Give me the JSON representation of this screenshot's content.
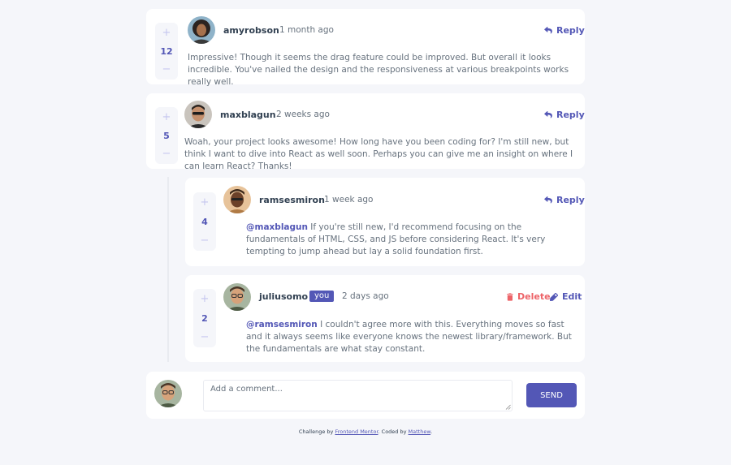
{
  "colors": {
    "accent": "#5357b6",
    "delete": "#ed6368",
    "background": "#f5f6fa",
    "card": "#ffffff",
    "vote_button": "#c5c6ef"
  },
  "vote": {
    "up_symbol": "+",
    "down_symbol": "−"
  },
  "comments": [
    {
      "score": "12",
      "username": "amyrobson",
      "time": "1 month ago",
      "reply_label": "Reply",
      "content": "Impressive! Though it seems the drag feature could be improved. But overall it looks incredible. You've nailed the design and the responsiveness at various breakpoints works really well."
    },
    {
      "score": "5",
      "username": "maxblagun",
      "time": "2 weeks ago",
      "reply_label": "Reply",
      "content": "Woah, your project looks awesome! How long have you been coding for? I'm still new, but think I want to dive into React as well soon. Perhaps you can give me an insight on where I can learn React? Thanks!"
    }
  ],
  "replies": [
    {
      "score": "4",
      "username": "ramsesmiron",
      "time": "1 week ago",
      "reply_label": "Reply",
      "mention": "@maxblagun",
      "content": " If you're still new, I'd recommend focusing on the fundamentals of HTML, CSS, and JS before considering React. It's very tempting to jump ahead but lay a solid foundation first."
    },
    {
      "score": "2",
      "username": "juliusomo",
      "you_badge": "you",
      "time": "2 days ago",
      "delete_label": "Delete",
      "edit_label": "Edit",
      "mention": "@ramsesmiron",
      "content": " I couldn't agree more with this. Everything moves so fast and it always seems like everyone knows the newest library/framework. But the fundamentals are what stay constant."
    }
  ],
  "new_comment": {
    "placeholder": "Add a comment...",
    "send_label": "SEND"
  },
  "footer": {
    "prefix": "Challenge by ",
    "challenge_link": "Frontend Mentor",
    "middle": ". Coded by ",
    "author_link": "Matthew",
    "suffix": "."
  }
}
